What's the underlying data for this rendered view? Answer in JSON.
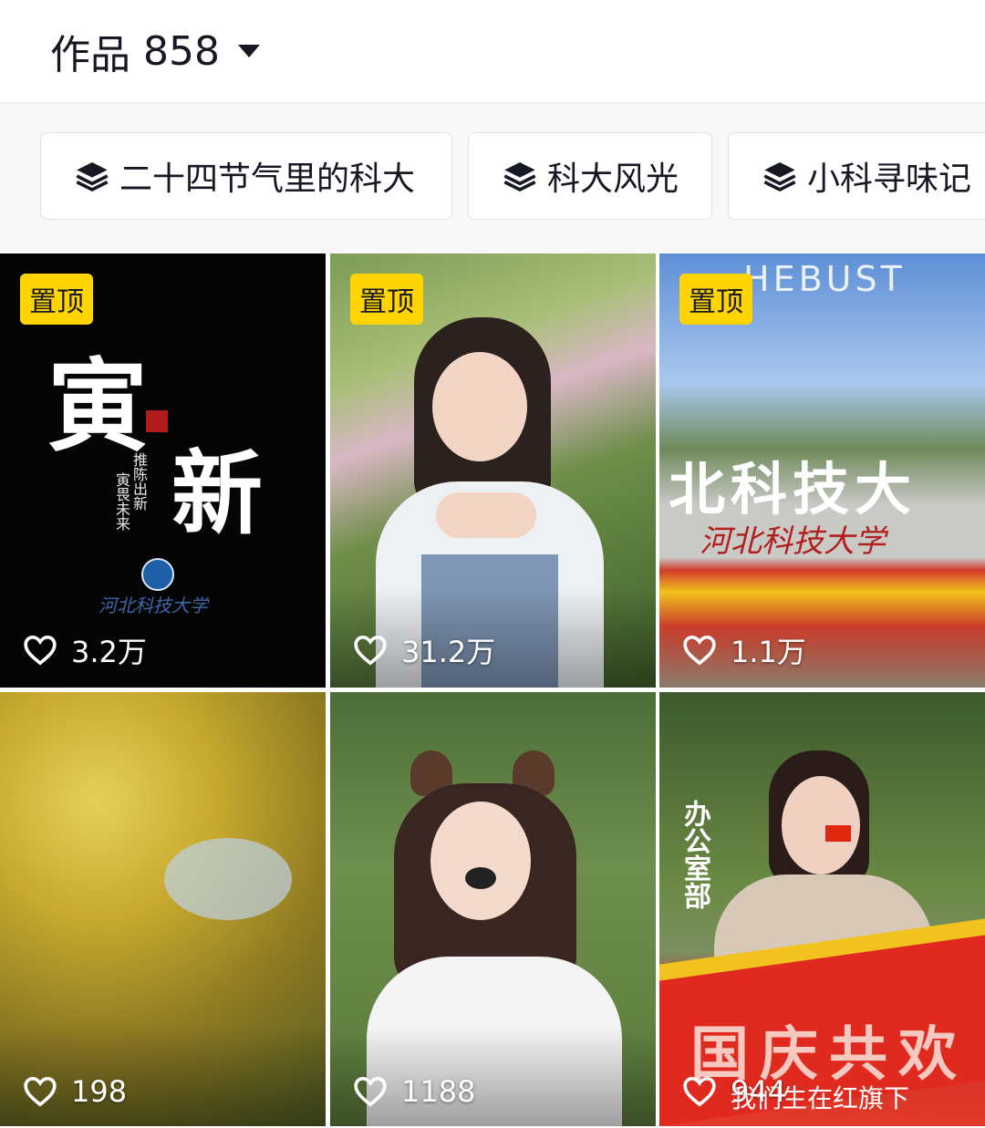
{
  "header": {
    "works_label": "作品",
    "works_count": "858"
  },
  "collections": [
    {
      "label": "二十四节气里的科大",
      "icon": "stack-icon"
    },
    {
      "label": "科大风光",
      "icon": "stack-icon"
    },
    {
      "label": "小科寻味记",
      "icon": "stack-icon"
    }
  ],
  "videos": [
    {
      "pinned": "置顶",
      "likes": "3.2万",
      "texts": {
        "big1": "寅",
        "big2": "新",
        "vertical1": "推陈出新",
        "vertical2": "寅畏未来",
        "school": "河北科技大学"
      }
    },
    {
      "pinned": "置顶",
      "likes": "31.2万"
    },
    {
      "pinned": "置顶",
      "likes": "1.1万",
      "texts": {
        "top": "HEBUST",
        "wall": "北科技大",
        "red": "河北科技大学"
      }
    },
    {
      "likes": "198"
    },
    {
      "likes": "1188"
    },
    {
      "likes": "944",
      "texts": {
        "side": "办公室部",
        "banner": "国庆共欢",
        "caption": "我们生在红旗下"
      }
    }
  ],
  "colors": {
    "pin_bg": "#ffd400",
    "text": "#161823"
  }
}
